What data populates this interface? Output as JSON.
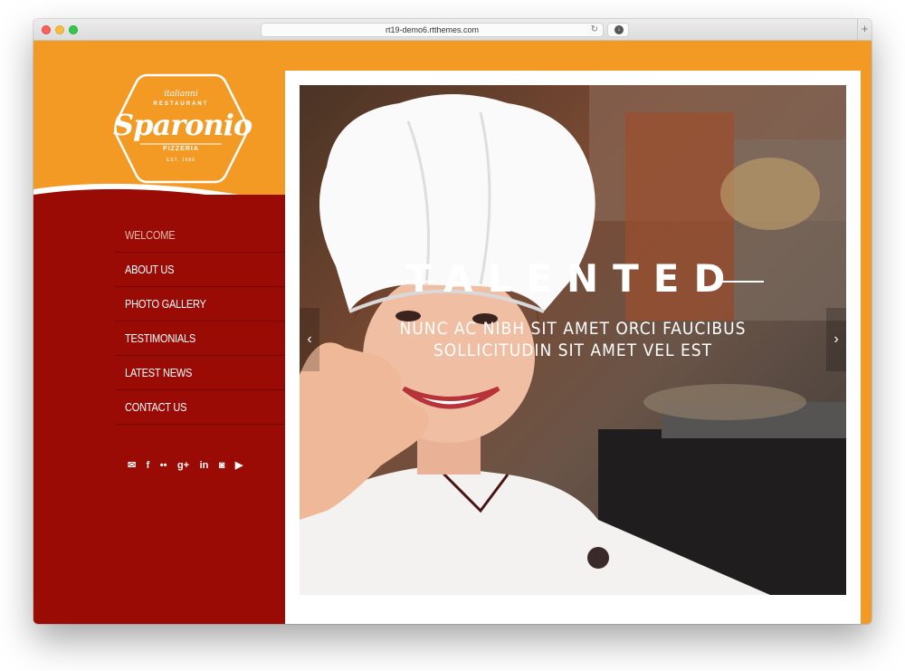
{
  "browser": {
    "url": "rt19-demo6.rtthemes.com",
    "reload_icon": "↻",
    "download_icon": "↓",
    "new_tab_icon": "+"
  },
  "logo": {
    "tagline_top": "italianni",
    "restaurant": "RESTAURANT",
    "name": "Sparonio",
    "pizzeria": "PIZZERIA",
    "est": "EST. 1986"
  },
  "nav": {
    "items": [
      {
        "label": "WELCOME",
        "active": true
      },
      {
        "label": "ABOUT US"
      },
      {
        "label": "PHOTO GALLERY"
      },
      {
        "label": "TESTIMONIALS"
      },
      {
        "label": "LATEST NEWS"
      },
      {
        "label": "CONTACT US"
      }
    ]
  },
  "social": {
    "email": "✉",
    "facebook": "f",
    "flickr": "••",
    "google_plus": "g+",
    "linkedin": "in",
    "instagram": "◙",
    "youtube": "▶"
  },
  "slider": {
    "title": "TALENTED",
    "subtitle_line1": "NUNC AC NIBH SIT AMET ORCI FAUCIBUS",
    "subtitle_line2": "SOLLICITUDIN SIT AMET VEL EST",
    "prev_icon": "‹",
    "next_icon": "›"
  },
  "colors": {
    "orange": "#f39a25",
    "red": "#9a0b05",
    "white": "#ffffff"
  }
}
